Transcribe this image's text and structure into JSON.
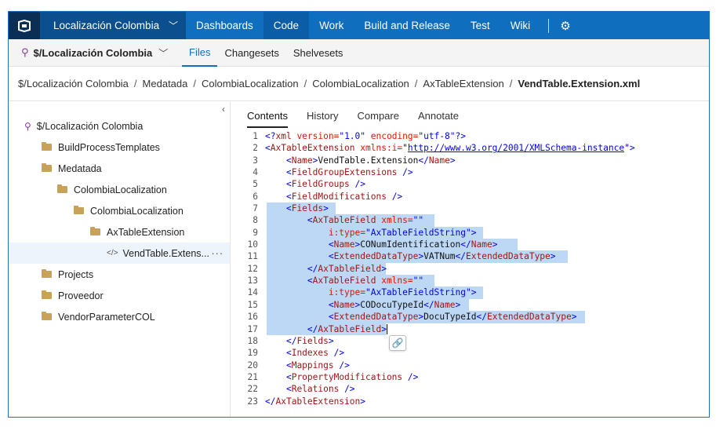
{
  "topnav": {
    "project": "Localización Colombia",
    "items": [
      "Dashboards",
      "Code",
      "Work",
      "Build and Release",
      "Test",
      "Wiki"
    ],
    "active_index": 1,
    "accent": "#106ebe"
  },
  "subnav": {
    "repo": "$/Localización Colombia",
    "tabs": [
      "Files",
      "Changesets",
      "Shelvesets"
    ],
    "active_index": 0
  },
  "breadcrumb": [
    "$/Localización Colombia",
    "Medatada",
    "ColombiaLocalization",
    "ColombiaLocalization",
    "AxTableExtension",
    "VendTable.Extension.xml"
  ],
  "tree": [
    {
      "label": "$/Localización Colombia",
      "type": "repo",
      "level": 0
    },
    {
      "label": "BuildProcessTemplates",
      "type": "folder",
      "level": 1
    },
    {
      "label": "Medatada",
      "type": "folder",
      "level": 1
    },
    {
      "label": "ColombiaLocalization",
      "type": "folder",
      "level": 2
    },
    {
      "label": "ColombiaLocalization",
      "type": "folder",
      "level": 3
    },
    {
      "label": "AxTableExtension",
      "type": "folder",
      "level": 4
    },
    {
      "label": "VendTable.Extens...",
      "type": "file",
      "level": 5,
      "selected": true
    },
    {
      "label": "Projects",
      "type": "folder",
      "level": 1
    },
    {
      "label": "Proveedor",
      "type": "folder",
      "level": 1
    },
    {
      "label": "VendorParameterCOL",
      "type": "folder",
      "level": 1
    }
  ],
  "content_tabs": [
    "Contents",
    "History",
    "Compare",
    "Annotate"
  ],
  "content_active": 0,
  "code_lines": [
    {
      "n": "1"
    },
    {
      "n": "2"
    },
    {
      "n": "3"
    },
    {
      "n": "4"
    },
    {
      "n": "5"
    },
    {
      "n": "6"
    },
    {
      "n": "7"
    },
    {
      "n": "8"
    },
    {
      "n": "9"
    },
    {
      "n": "10"
    },
    {
      "n": "11"
    },
    {
      "n": "12"
    },
    {
      "n": "13"
    },
    {
      "n": "14"
    },
    {
      "n": "15"
    },
    {
      "n": "16"
    },
    {
      "n": "17"
    },
    {
      "n": "18"
    },
    {
      "n": "19"
    },
    {
      "n": "20"
    },
    {
      "n": "21"
    },
    {
      "n": "22"
    },
    {
      "n": "23"
    }
  ],
  "code": {
    "l1_a": "<?",
    "l1_b": "xml",
    "l1_c": " version=",
    "l1_d": "\"1.0\"",
    "l1_e": " encoding=",
    "l1_f": "\"utf-8\"",
    "l1_g": "?>",
    "l2_a": "<",
    "l2_b": "AxTableExtension",
    "l2_c": " xmlns:i=",
    "l2_d": "\"",
    "l2_e": "http://www.w3.org/2001/XMLSchema-instance",
    "l2_f": "\"",
    "l2_g": ">",
    "l3_name": "VendTable.Extension",
    "l10_val": "CONumIdentification",
    "l11_val": "VATNum",
    "l15_val": "CODocuTypeId",
    "l16_val": "DocuTypeId"
  }
}
